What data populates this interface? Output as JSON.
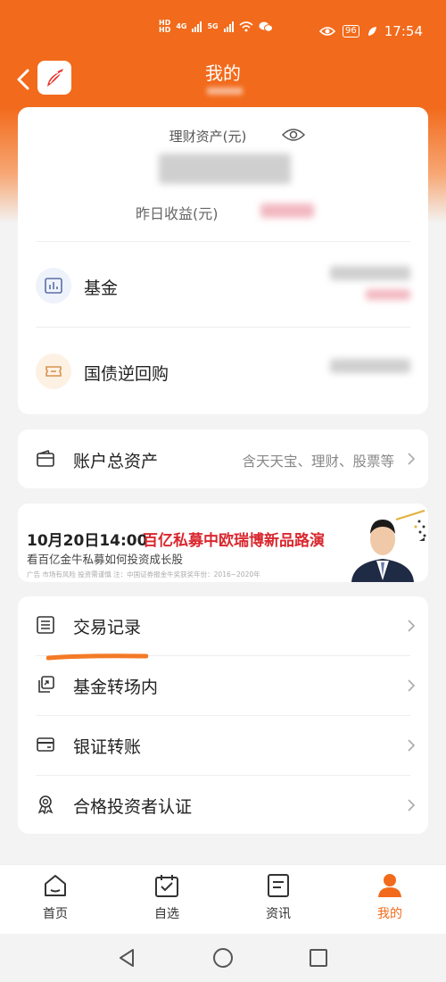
{
  "status": {
    "network_labels": [
      "HD",
      "HD",
      "4G",
      "5G"
    ],
    "battery": "96",
    "time": "17:54"
  },
  "header": {
    "title": "我的"
  },
  "assets": {
    "label": "理财资产(元)",
    "yesterday_label": "昨日收益(元)"
  },
  "holdings": [
    {
      "label": "基金",
      "icon": "fund-chart-icon"
    },
    {
      "label": "国债逆回购",
      "icon": "ticket-icon"
    }
  ],
  "total_assets": {
    "label": "账户总资产",
    "sub": "含天天宝、理财、股票等"
  },
  "banner": {
    "date": "10月20日14:00",
    "title": "百亿私募中欧瑞博新品路演",
    "subtitle": "看百亿金牛私募如何投资成长股",
    "note": "广告 市场有风险 投资需谨慎    注：中国证券报金牛奖获奖年份：2016~2020年"
  },
  "menu": [
    {
      "label": "交易记录",
      "icon": "list-icon"
    },
    {
      "label": "基金转场内",
      "icon": "transfer-icon"
    },
    {
      "label": "银证转账",
      "icon": "card-icon"
    },
    {
      "label": "合格投资者认证",
      "icon": "badge-icon"
    }
  ],
  "nav": [
    {
      "label": "首页",
      "icon": "home-icon"
    },
    {
      "label": "自选",
      "icon": "watchlist-icon"
    },
    {
      "label": "资讯",
      "icon": "news-icon"
    },
    {
      "label": "我的",
      "icon": "profile-icon"
    }
  ],
  "colors": {
    "brand": "#f26a1b",
    "banner_title": "#d9282f"
  }
}
